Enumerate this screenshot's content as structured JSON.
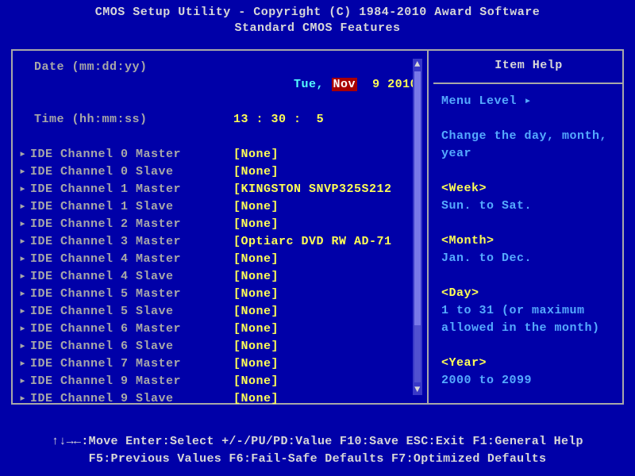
{
  "header": {
    "line1": "CMOS Setup Utility - Copyright (C) 1984-2010 Award Software",
    "line2": "Standard CMOS Features"
  },
  "date_row": {
    "label": "  Date (mm:dd:yy)",
    "weekday": "Tue,",
    "month": "Nov",
    "day": "9",
    "year": "2010"
  },
  "time_row": {
    "label": "  Time (hh:mm:ss)",
    "hh": "13",
    "mm": "30",
    "ss": "5"
  },
  "channels": [
    {
      "label": "IDE Channel 0 Master",
      "value": "[None]"
    },
    {
      "label": "IDE Channel 0 Slave",
      "value": "[None]"
    },
    {
      "label": "IDE Channel 1 Master",
      "value": "[KINGSTON SNVP325S212"
    },
    {
      "label": "IDE Channel 1 Slave",
      "value": "[None]"
    },
    {
      "label": "IDE Channel 2 Master",
      "value": "[None]"
    },
    {
      "label": "IDE Channel 3 Master",
      "value": "[Optiarc DVD RW AD-71"
    },
    {
      "label": "IDE Channel 4 Master",
      "value": "[None]"
    },
    {
      "label": "IDE Channel 4 Slave",
      "value": "[None]"
    },
    {
      "label": "IDE Channel 5 Master",
      "value": "[None]"
    },
    {
      "label": "IDE Channel 5 Slave",
      "value": "[None]"
    },
    {
      "label": "IDE Channel 6 Master",
      "value": "[None]"
    },
    {
      "label": "IDE Channel 6 Slave",
      "value": "[None]"
    },
    {
      "label": "IDE Channel 7 Master",
      "value": "[None]"
    },
    {
      "label": "IDE Channel 9 Master",
      "value": "[None]"
    },
    {
      "label": "IDE Channel 9 Slave",
      "value": "[None]"
    }
  ],
  "help": {
    "title": "Item Help",
    "menu_level": "Menu Level",
    "desc": "Change the day, month, year",
    "week_h": "<Week>",
    "week_t": "Sun. to Sat.",
    "month_h": "<Month>",
    "month_t": "Jan. to Dec.",
    "day_h": "<Day>",
    "day_t": "1 to 31 (or maximum allowed in the month)",
    "year_h": "<Year>",
    "year_t": "2000 to 2099"
  },
  "footer": {
    "line1": "↑↓→←:Move   Enter:Select   +/-/PU/PD:Value   F10:Save   ESC:Exit   F1:General Help",
    "line2": "F5:Previous Values   F6:Fail-Safe Defaults   F7:Optimized Defaults"
  },
  "glyph": {
    "tri": "▸",
    "rtri": "▸"
  }
}
